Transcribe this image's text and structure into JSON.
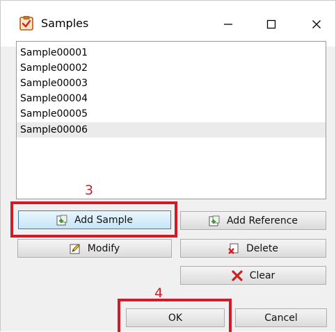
{
  "window": {
    "title": "Samples",
    "icon": "checklist-clipboard-icon"
  },
  "titlebar_controls": {
    "minimize": "minimize-icon",
    "maximize": "maximize-icon",
    "close": "close-icon"
  },
  "samples_list": {
    "items": [
      "Sample00001",
      "Sample00002",
      "Sample00003",
      "Sample00004",
      "Sample00005",
      "Sample00006"
    ],
    "selected_index": 5
  },
  "buttons": {
    "add_sample": "Add Sample",
    "add_reference": "Add Reference",
    "modify": "Modify",
    "delete": "Delete",
    "clear": "Clear",
    "ok": "OK",
    "cancel": "Cancel"
  },
  "annotations": {
    "step_add_sample": "3",
    "step_ok": "4",
    "highlight_color": "#d11b29"
  },
  "colors": {
    "selection": "#ebebeb",
    "focus_border": "#3c7fb1",
    "add_icon_green": "#3a9b2d",
    "delete_icon_red": "#cc1f1f"
  }
}
